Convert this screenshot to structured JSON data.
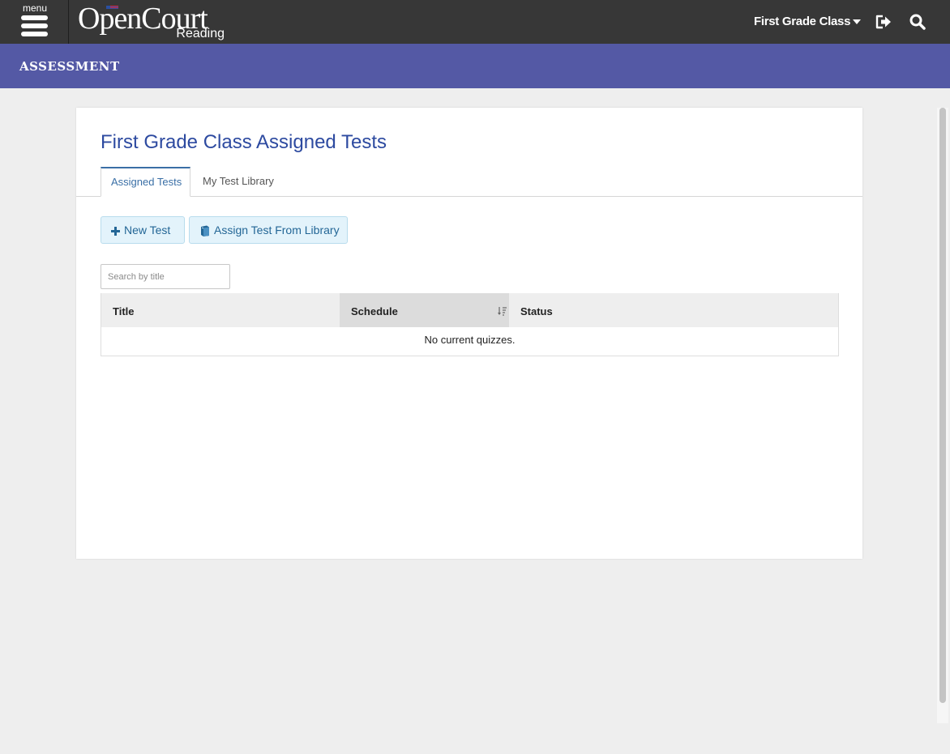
{
  "header": {
    "menu_label": "menu",
    "logo_main": "OpenCourt",
    "logo_sub": "Reading",
    "class_selector": "First Grade Class",
    "icons": [
      "hamburger-icon",
      "caret-down-icon",
      "logout-icon",
      "search-icon"
    ]
  },
  "banner": {
    "title": "ASSESSMENT",
    "color": "#5459a5"
  },
  "page": {
    "title": "First Grade Class Assigned Tests",
    "tabs": [
      {
        "label": "Assigned Tests",
        "active": true
      },
      {
        "label": "My Test Library",
        "active": false
      }
    ],
    "buttons": {
      "new_test": "New Test",
      "assign_from_library": "Assign Test From Library"
    },
    "search": {
      "placeholder": "Search by title",
      "value": ""
    },
    "table": {
      "columns": [
        "Title",
        "Schedule",
        "Status"
      ],
      "sorted_column": "Schedule",
      "empty_message": "No current quizzes."
    }
  },
  "colors": {
    "topbar": "#373737",
    "title_blue": "#2d4aa0",
    "button_bg": "#e3f3fb",
    "button_text": "#236696"
  }
}
